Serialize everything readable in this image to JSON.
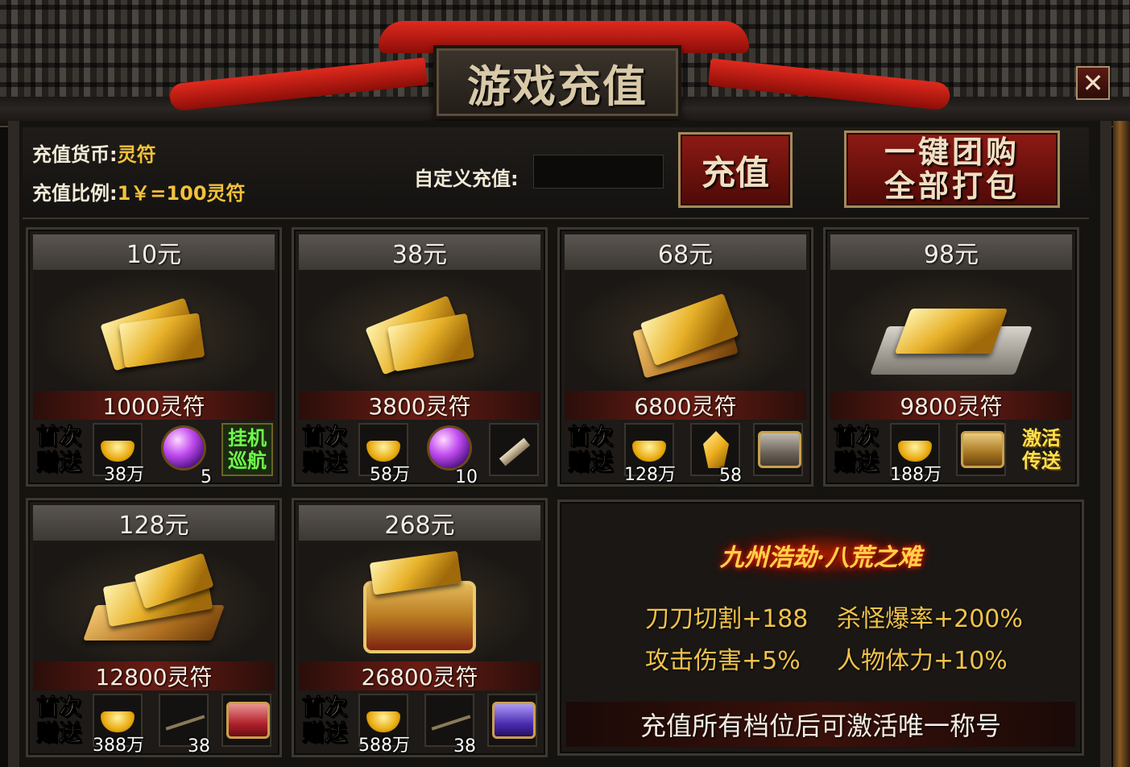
{
  "window": {
    "title": "游戏充值",
    "close_label": "✕"
  },
  "header": {
    "currency_label": "充值货币:",
    "currency_value": "灵符",
    "ratio_label": "充值比例:",
    "ratio_value": "1￥=100灵符",
    "custom_label": "自定义充值:",
    "custom_value": "",
    "recharge_button": "充值",
    "bundle_button_line1": "一键团购",
    "bundle_button_line2": "全部打包"
  },
  "first_gift_label": [
    "首次",
    "赠送"
  ],
  "packages": [
    {
      "price": "10元",
      "amount": "1000灵符",
      "gifts": [
        {
          "icon": "gold-ingot-icon",
          "qty": "38万"
        },
        {
          "icon": "purple-orb-icon",
          "qty": "5"
        }
      ],
      "extra_text": [
        "挂机",
        "巡航"
      ],
      "extra_style": "green"
    },
    {
      "price": "38元",
      "amount": "3800灵符",
      "gifts": [
        {
          "icon": "gold-ingot-icon",
          "qty": "58万"
        },
        {
          "icon": "purple-orb-icon",
          "qty": "10"
        },
        {
          "icon": "scroll-icon",
          "qty": ""
        }
      ]
    },
    {
      "price": "68元",
      "amount": "6800灵符",
      "gifts": [
        {
          "icon": "gold-ingot-icon",
          "qty": "128万"
        },
        {
          "icon": "gold-crystal-icon",
          "qty": "58"
        },
        {
          "icon": "silver-chest-icon",
          "qty": ""
        }
      ]
    },
    {
      "price": "98元",
      "amount": "9800灵符",
      "gifts": [
        {
          "icon": "gold-ingot-icon",
          "qty": "188万"
        },
        {
          "icon": "gold-chest-icon",
          "qty": ""
        }
      ],
      "extra_text": [
        "激活",
        "传送"
      ],
      "extra_style": "yellow"
    },
    {
      "price": "128元",
      "amount": "12800灵符",
      "gifts": [
        {
          "icon": "gold-ingot-icon",
          "qty": "388万"
        },
        {
          "icon": "fishing-rod-icon",
          "qty": "38"
        },
        {
          "icon": "red-chest-icon",
          "qty": ""
        }
      ]
    },
    {
      "price": "268元",
      "amount": "26800灵符",
      "gifts": [
        {
          "icon": "gold-ingot-icon",
          "qty": "588万"
        },
        {
          "icon": "fishing-rod-icon",
          "qty": "38"
        },
        {
          "icon": "purple-chest-icon",
          "qty": ""
        }
      ]
    }
  ],
  "bonus": {
    "title": "九州浩劫·八荒之难",
    "stats": [
      "刀刀切割+188",
      "杀怪爆率+200%",
      "攻击伤害+5%",
      "人物体力+10%"
    ],
    "footer": "充值所有档位后可激活唯一称号"
  }
}
